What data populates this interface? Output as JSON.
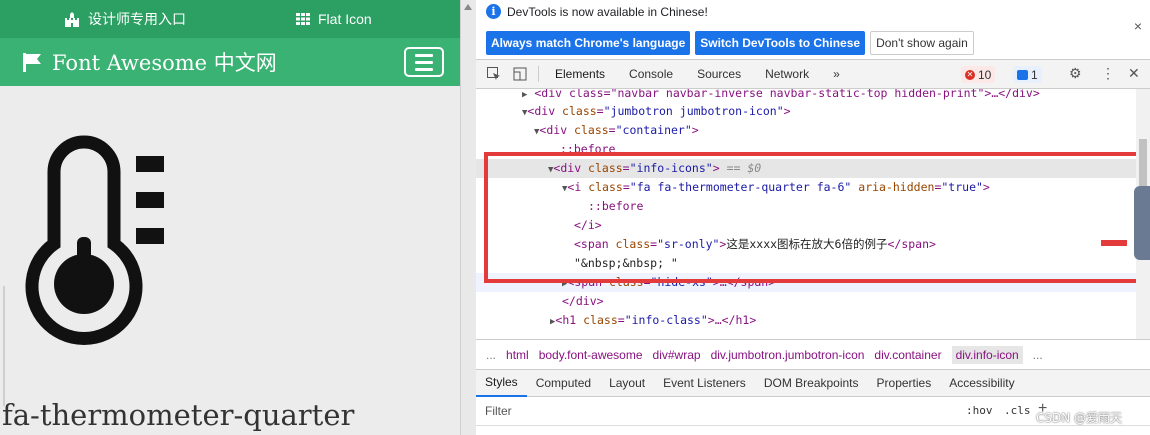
{
  "site": {
    "topbar": {
      "designer_entry": "设计师专用入口",
      "flat_icon": "Flat Icon"
    },
    "navbar": {
      "brand": "Font Awesome 中文网"
    },
    "icon_name": "fa-thermometer-quarter"
  },
  "devtools": {
    "infobar": {
      "message": "DevTools is now available in Chinese!",
      "btn_match": "Always match Chrome's language",
      "btn_switch": "Switch DevTools to Chinese",
      "btn_dont_show": "Don't show again",
      "close": "×"
    },
    "tabs": [
      "Elements",
      "Console",
      "Sources",
      "Network",
      "»"
    ],
    "errors_count": "10",
    "messages_count": "1",
    "code": {
      "l0_tag": "<div class=\"navbar navbar-inverse navbar-static-top hidden-print\">…</div>",
      "l1_a": "<div ",
      "l1_attr": "class",
      "l1_val": "\"jumbotron jumbotron-icon\"",
      "l1_end": ">",
      "l2_a": "<div ",
      "l2_attr": "class",
      "l2_val": "\"container\"",
      "l2_end": ">",
      "l3": "::before",
      "l4_a": "<div ",
      "l4_attr": "class",
      "l4_val": "\"info-icons\"",
      "l4_end": ">",
      "l4_eq": "== $0",
      "l5_a": "<i ",
      "l5_attr1": "class",
      "l5_val1": "\"fa fa-thermometer-quarter fa-6\"",
      "l5_attr2": "aria-hidden",
      "l5_val2": "\"true\"",
      "l5_end": ">",
      "l6": "::before",
      "l7": "</i>",
      "l8_a": "<span ",
      "l8_attr": "class",
      "l8_val": "\"sr-only\"",
      "l8_end": ">",
      "l8_text": "这是xxxx图标在放大6倍的例子",
      "l8_close": "</span>",
      "l9": "\"&nbsp;&nbsp; \"",
      "l10_a": "<span ",
      "l10_attr": "class",
      "l10_val": "\"hide-xs\"",
      "l10_end": ">…</span>",
      "l11": "</div>",
      "l12_a": "<h1 ",
      "l12_attr": "class",
      "l12_val": "\"info-class\"",
      "l12_end": ">…</h1>"
    },
    "breadcrumbs": [
      "...",
      "html",
      "body.font-awesome",
      "div#wrap",
      "div.jumbotron.jumbotron-icon",
      "div.container",
      "div.info-icon",
      "..."
    ],
    "subtabs": [
      "Styles",
      "Computed",
      "Layout",
      "Event Listeners",
      "DOM Breakpoints",
      "Properties",
      "Accessibility"
    ],
    "filter_placeholder": "Filter",
    "hov": ":hov",
    "cls": ".cls",
    "watermark": "CSDN @爱雨天"
  },
  "colors": {
    "site_green_dark": "#2c9f63",
    "site_green": "#3ab273",
    "accent_blue": "#1a73e8",
    "highlight_red": "#e33b3b"
  }
}
